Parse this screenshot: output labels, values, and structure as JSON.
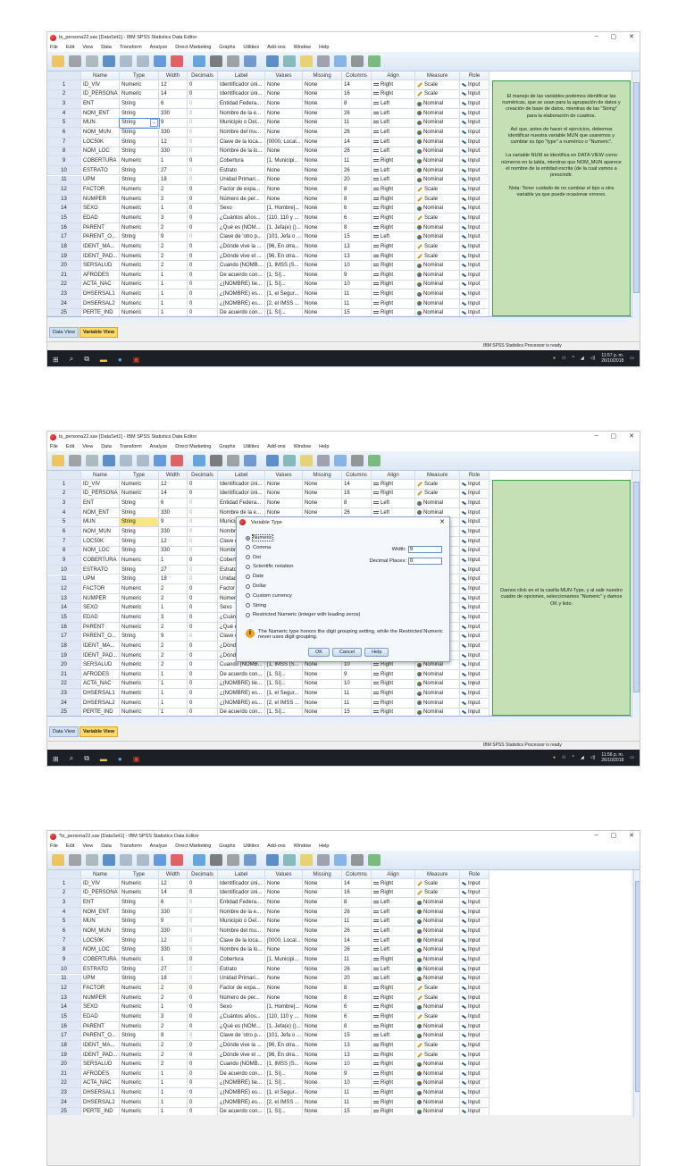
{
  "windows": [
    {
      "title": "ts_persona22.sav [DataSet1] - IBM SPSS Statistics Data Editor",
      "time": "11:57 p. m.",
      "date": "26/10/2018",
      "selected_row": 5,
      "mode": "button",
      "note": "panel1"
    },
    {
      "title": "ts_persona22.sav [DataSet1] - IBM SPSS Statistics Data Editor",
      "time": "11:56 p. m.",
      "date": "26/10/2018",
      "selected_row": 5,
      "mode": "yellow",
      "note": "panel2",
      "dialog": true
    },
    {
      "title": "*ts_persona22.sav [DataSet1] - IBM SPSS Statistics Data Editor",
      "time": "",
      "date": "",
      "selected_row": 0,
      "mode": "none",
      "note": ""
    }
  ],
  "window_controls": [
    "–",
    "▢",
    "✕"
  ],
  "menu": [
    "File",
    "Edit",
    "View",
    "Data",
    "Transform",
    "Analyze",
    "Direct Marketing",
    "Graphs",
    "Utilities",
    "Add-ons",
    "Window",
    "Help"
  ],
  "columns": [
    "",
    "Name",
    "Type",
    "Width",
    "Decimals",
    "Label",
    "Values",
    "Missing",
    "Columns",
    "Align",
    "Measure",
    "Role"
  ],
  "rows": [
    [
      "1",
      "ID_VIV",
      "Numeric",
      "12",
      "0",
      "Identificador úni...",
      "None",
      "None",
      "14",
      "Right",
      "Scale",
      "Input"
    ],
    [
      "2",
      "ID_PERSONA",
      "Numeric",
      "14",
      "0",
      "Identificador úni...",
      "None",
      "None",
      "16",
      "Right",
      "Scale",
      "Input"
    ],
    [
      "3",
      "ENT",
      "String",
      "6",
      "0",
      "Entidad Federa...",
      "None",
      "None",
      "8",
      "Left",
      "Nominal",
      "Input"
    ],
    [
      "4",
      "NOM_ENT",
      "String",
      "330",
      "0",
      "Nombre de la e...",
      "None",
      "None",
      "26",
      "Left",
      "Nominal",
      "Input"
    ],
    [
      "5",
      "MUN",
      "String",
      "9",
      "0",
      "Municipio o Del...",
      "None",
      "None",
      "11",
      "Left",
      "Nominal",
      "Input"
    ],
    [
      "6",
      "NOM_MUN",
      "String",
      "330",
      "0",
      "Nombre del mu...",
      "None",
      "None",
      "26",
      "Left",
      "Nominal",
      "Input"
    ],
    [
      "7",
      "LOC50K",
      "String",
      "12",
      "0",
      "Clave de la loca...",
      "[0000, Local...",
      "None",
      "14",
      "Left",
      "Nominal",
      "Input"
    ],
    [
      "8",
      "NOM_LOC",
      "String",
      "330",
      "0",
      "Nombre de la lo...",
      "None",
      "None",
      "26",
      "Left",
      "Nominal",
      "Input"
    ],
    [
      "9",
      "COBERTURA",
      "Numeric",
      "1",
      "0",
      "Cobertura",
      "[1, Municipi...",
      "None",
      "11",
      "Right",
      "Nominal",
      "Input"
    ],
    [
      "10",
      "ESTRATO",
      "String",
      "27",
      "0",
      "Estrato",
      "None",
      "None",
      "26",
      "Left",
      "Nominal",
      "Input"
    ],
    [
      "11",
      "UPM",
      "String",
      "18",
      "0",
      "Unidad Primari...",
      "None",
      "None",
      "20",
      "Left",
      "Nominal",
      "Input"
    ],
    [
      "12",
      "FACTOR",
      "Numeric",
      "2",
      "0",
      "Factor de expa...",
      "None",
      "None",
      "8",
      "Right",
      "Scale",
      "Input"
    ],
    [
      "13",
      "NUMPER",
      "Numeric",
      "2",
      "0",
      "Número de per...",
      "None",
      "None",
      "8",
      "Right",
      "Scale",
      "Input"
    ],
    [
      "14",
      "SEXO",
      "Numeric",
      "1",
      "0",
      "Sexo",
      "[1, Hombre]...",
      "None",
      "6",
      "Right",
      "Nominal",
      "Input"
    ],
    [
      "15",
      "EDAD",
      "Numeric",
      "3",
      "0",
      "¿Cuántos años...",
      "[110, 110 y ...",
      "None",
      "6",
      "Right",
      "Scale",
      "Input"
    ],
    [
      "16",
      "PARENT",
      "Numeric",
      "2",
      "0",
      "¿Qué es (NOM...",
      "[1, Jefa(e) ()...",
      "None",
      "8",
      "Right",
      "Nominal",
      "Input"
    ],
    [
      "17",
      "PARENT_O...",
      "String",
      "9",
      "0",
      "Clave de 'otro p...",
      "[101, Jefa o ...",
      "None",
      "15",
      "Left",
      "Nominal",
      "Input"
    ],
    [
      "18",
      "IDENT_MA...",
      "Numeric",
      "2",
      "0",
      "¿Dónde vive la ...",
      "[96, En otra...",
      "None",
      "13",
      "Right",
      "Scale",
      "Input"
    ],
    [
      "19",
      "IDENT_PAD...",
      "Numeric",
      "2",
      "0",
      "¿Dónde vive el ...",
      "[96, En otra...",
      "None",
      "13",
      "Right",
      "Scale",
      "Input"
    ],
    [
      "20",
      "SERSALUD",
      "Numeric",
      "2",
      "0",
      "Cuando (NOMB...",
      "[1, IMSS (S...",
      "None",
      "10",
      "Right",
      "Nominal",
      "Input"
    ],
    [
      "21",
      "AFRODES",
      "Numeric",
      "1",
      "0",
      "De acuerdo con...",
      "[1, Sí]...",
      "None",
      "9",
      "Right",
      "Nominal",
      "Input"
    ],
    [
      "22",
      "ACTA_NAC",
      "Numeric",
      "1",
      "0",
      "¿(NOMBRE) tie...",
      "[1, Sí]...",
      "None",
      "10",
      "Right",
      "Nominal",
      "Input"
    ],
    [
      "23",
      "DHSERSAL1",
      "Numeric",
      "1",
      "0",
      "¿(NOMBRE) es...",
      "[1, el Segur...",
      "None",
      "11",
      "Right",
      "Nominal",
      "Input"
    ],
    [
      "24",
      "DHSERSAL2",
      "Numeric",
      "1",
      "0",
      "¿(NOMBRE) es...",
      "[2, el IMSS ...",
      "None",
      "11",
      "Right",
      "Nominal",
      "Input"
    ],
    [
      "25",
      "PERTE_IND",
      "Numeric",
      "1",
      "0",
      "De acuerdo con...",
      "[1, Sí]...",
      "None",
      "15",
      "Right",
      "Nominal",
      "Input"
    ]
  ],
  "tabs": [
    "Data View",
    "Variable View"
  ],
  "status": "IBM SPSS Statistics Processor is ready",
  "notes": {
    "panel1": [
      "El manejo de las variables podemos identificar las numéricas, que se usan para la agrupación de datos y creación de base de datos, mientras de las \"String\" para la elaboración de cuadros.",
      "Así que, antes de hacer el ejercicios, debemos identificar nuestra variable MUN que usaremos y cambiar su tipo \"type\" a numérico o \"Numeric\".",
      "La variable NUM se identifica en DATA VIEW como números en la tabla, mientras que NOM_MUN aparece el nombre de la entidad escrita (de la cual vamos a prescindir.",
      "Nota: Tener cuidado de no cambiar el tipo a otra variable ya que puede ocasionar errores."
    ],
    "panel2": [
      "Damos click en el la casilla MUN-Type, y al salir nuestro cuadro de opciones, seleccionamos \"Numeric\" y damos OK y listo."
    ]
  },
  "dialog": {
    "title": "Variable Type",
    "options": [
      "Numeric",
      "Comma",
      "Dot",
      "Scientific notation",
      "Date",
      "Dollar",
      "Custom currency",
      "String",
      "Restricted Numeric (integer with leading zeros)"
    ],
    "selected": "Numeric",
    "width_label": "Width:",
    "width_value": "9",
    "decimals_label": "Decimal Places:",
    "decimals_value": "0",
    "info": "The Numeric type honors the digit grouping setting, while the Restricted Numeric never uses digit grouping.",
    "buttons": [
      "OK",
      "Cancel",
      "Help"
    ]
  }
}
